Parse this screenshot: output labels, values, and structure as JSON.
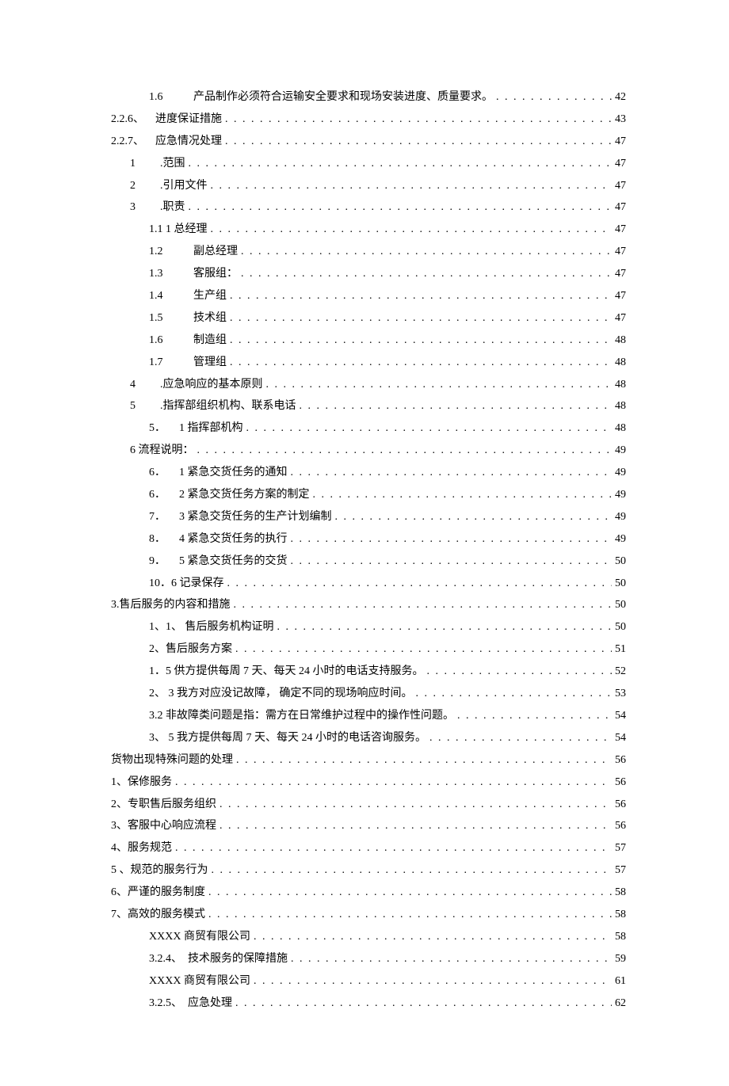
{
  "toc": [
    {
      "indent": 2,
      "num": "1.6",
      "numClass": "num-gap-wide",
      "title": "产品制作必须符合运输安全要求和现场安装进度、质量要求。",
      "page": "42"
    },
    {
      "indent": 0,
      "num": "2.2.6、",
      "numClass": "num-gap-wide",
      "title": "进度保证措施",
      "page": "43"
    },
    {
      "indent": 0,
      "num": "2.2.7、",
      "numClass": "num-gap-wide",
      "title": "应急情况处理",
      "page": "47"
    },
    {
      "indent": 1,
      "num": "1",
      "numClass": "num-gap",
      "title": ".范围",
      "page": "47"
    },
    {
      "indent": 1,
      "num": "2",
      "numClass": "num-gap",
      "title": ".引用文件",
      "page": "47"
    },
    {
      "indent": 1,
      "num": "3",
      "numClass": "num-gap",
      "title": ".职责",
      "page": "47"
    },
    {
      "indent": 2,
      "num": "",
      "numClass": "",
      "title": "1.1 1 总经理",
      "page": "47"
    },
    {
      "indent": 2,
      "num": "1.2",
      "numClass": "num-gap-wide",
      "title": "副总经理",
      "page": "47"
    },
    {
      "indent": 2,
      "num": "1.3",
      "numClass": "num-gap-wide",
      "title": "客服组：",
      "page": "47"
    },
    {
      "indent": 2,
      "num": "1.4",
      "numClass": "num-gap-wide",
      "title": "生产组",
      "page": "47"
    },
    {
      "indent": 2,
      "num": "1.5",
      "numClass": "num-gap-wide",
      "title": "技术组",
      "page": "47"
    },
    {
      "indent": 2,
      "num": "1.6",
      "numClass": "num-gap-wide",
      "title": "制造组",
      "page": "48"
    },
    {
      "indent": 2,
      "num": "1.7",
      "numClass": "num-gap-wide",
      "title": "管理组",
      "page": "48"
    },
    {
      "indent": 1,
      "num": "4",
      "numClass": "num-gap",
      "title": ".应急响应的基本原则",
      "page": "48"
    },
    {
      "indent": 1,
      "num": "5",
      "numClass": "num-gap",
      "title": ".指挥部组织机构、联系电话",
      "page": "48"
    },
    {
      "indent": 2,
      "num": "5．",
      "numClass": "num-gap",
      "title": "1 指挥部机构",
      "page": "48"
    },
    {
      "indent": 1,
      "num": "",
      "numClass": "",
      "title": "6 流程说明：",
      "page": "49"
    },
    {
      "indent": 2,
      "num": "6．",
      "numClass": "num-gap",
      "title": "1 紧急交货任务的通知",
      "page": "49"
    },
    {
      "indent": 2,
      "num": "6．",
      "numClass": "num-gap",
      "title": "2 紧急交货任务方案的制定",
      "page": "49"
    },
    {
      "indent": 2,
      "num": "7．",
      "numClass": "num-gap",
      "title": "3 紧急交货任务的生产计划编制",
      "page": "49"
    },
    {
      "indent": 2,
      "num": "8．",
      "numClass": "num-gap",
      "title": "4 紧急交货任务的执行",
      "page": "49"
    },
    {
      "indent": 2,
      "num": "9．",
      "numClass": "num-gap",
      "title": "5 紧急交货任务的交货",
      "page": "50"
    },
    {
      "indent": 2,
      "num": "",
      "numClass": "",
      "title": "10．6 记录保存",
      "page": "50"
    },
    {
      "indent": 0,
      "num": "",
      "numClass": "",
      "title": "3.售后服务的内容和措施",
      "page": "50"
    },
    {
      "indent": 2,
      "num": "",
      "numClass": "",
      "title": "1、1、 售后服务机构证明 ",
      "page": "50"
    },
    {
      "indent": 2,
      "num": "",
      "numClass": "",
      "title": "2、售后服务方案",
      "page": "51"
    },
    {
      "indent": 2,
      "num": "",
      "numClass": "",
      "title": "1．5 供方提供每周 7 天、每天 24 小时的电话支持服务。",
      "page": "52"
    },
    {
      "indent": 2,
      "num": "",
      "numClass": "",
      "title": "2、 3 我方对应没记故障， 确定不同的现场响应时间。",
      "page": "53"
    },
    {
      "indent": 2,
      "num": "",
      "numClass": "",
      "title": "3.2 非故障类问题是指：需方在日常维护过程中的操作性问题。",
      "page": "54"
    },
    {
      "indent": 2,
      "num": "",
      "numClass": "",
      "title": "3、 5 我方提供每周 7 天、每天 24 小时的电话咨询服务。",
      "page": "54"
    },
    {
      "indent": 0,
      "num": "",
      "numClass": "",
      "title": "货物出现特殊问题的处理 ",
      "page": "56"
    },
    {
      "indent": 0,
      "num": "",
      "numClass": "",
      "title": "1、保修服务 ",
      "page": "56"
    },
    {
      "indent": 0,
      "num": "",
      "numClass": "",
      "title": "2、专职售后服务组织 ",
      "page": "56"
    },
    {
      "indent": 0,
      "num": "",
      "numClass": "",
      "title": "3、客服中心响应流程 ",
      "page": "56"
    },
    {
      "indent": 0,
      "num": "",
      "numClass": "",
      "title": "4、服务规范 ",
      "page": "57"
    },
    {
      "indent": 0,
      "num": "",
      "numClass": "",
      "title": "5 、规范的服务行为 ",
      "page": "57"
    },
    {
      "indent": 0,
      "num": "",
      "numClass": "",
      "title": "6、严谨的服务制度 ",
      "page": "58"
    },
    {
      "indent": 0,
      "num": "",
      "numClass": "",
      "title": "7、高效的服务模式 ",
      "page": "58"
    },
    {
      "indent": 2,
      "num": "",
      "numClass": "",
      "title": "XXXX 商贸有限公司 ",
      "page": "58"
    },
    {
      "indent": 2,
      "num": "",
      "numClass": "",
      "title": "3.2.4、　技术服务的保障措施",
      "page": "59"
    },
    {
      "indent": 2,
      "num": "",
      "numClass": "",
      "title": "XXXX 商贸有限公司 ",
      "page": "61"
    },
    {
      "indent": 2,
      "num": "",
      "numClass": "",
      "title": "3.2.5、　应急处理",
      "page": "62"
    }
  ]
}
